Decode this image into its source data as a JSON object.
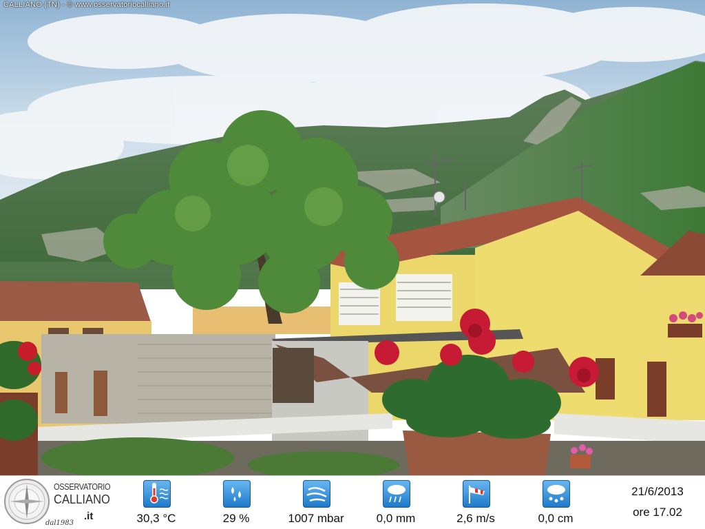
{
  "caption": "CALLIANO (TN) - © www.osservatoriocalliano.it",
  "logo": {
    "line1": "OSSERVATORIO",
    "line2": "CALLIANO",
    "line3": ".it",
    "line4": "dal1983"
  },
  "readings": [
    {
      "icon": "thermometer-icon",
      "value": "30,3 °C"
    },
    {
      "icon": "humidity-drops-icon",
      "value": "29 %"
    },
    {
      "icon": "pressure-icon",
      "value": "1007 mbar"
    },
    {
      "icon": "rain-cloud-icon",
      "value": "0,0 mm"
    },
    {
      "icon": "windsock-icon",
      "value": "2,6 m/s"
    },
    {
      "icon": "snow-cloud-icon",
      "value": "0,0 cm"
    }
  ],
  "date": "21/6/2013",
  "time": "ore 17.02"
}
